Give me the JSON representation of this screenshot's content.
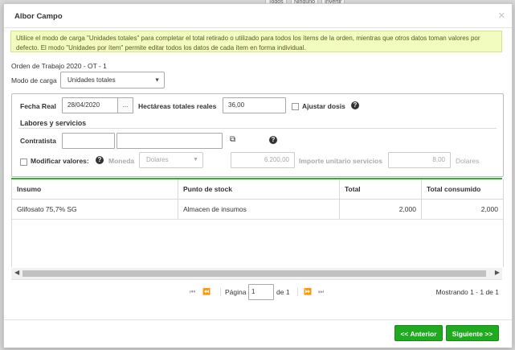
{
  "background": {
    "tabs": [
      "Todos",
      "Ninguno",
      "Invertir"
    ]
  },
  "dialog": {
    "title": "Albor Campo",
    "close_icon": "close-icon",
    "info": "Utilice el modo de carga \"Unidades totales\" para completar el total retirado o utilizado para todos los ítems de la orden, mientras que otros datos toman valores por defecto. El modo \"Unidades por ítem\" permite editar todos los datos de cada ítem en forma individual.",
    "order_label": "Orden de Trabajo 2020 - OT - 1",
    "mode_label": "Modo de carga",
    "mode_value": "Unidades totales",
    "form": {
      "fecha_label": "Fecha Real",
      "fecha_value": "28/04/2020",
      "fecha_btn": "...",
      "hectareas_label": "Hectáreas totales reales",
      "hectareas_value": "36,00",
      "ajustar_label": "Ajustar dosis",
      "section_title": "Labores y servicios",
      "contratista_label": "Contratista",
      "contratista_code": "",
      "contratista_name": "",
      "modificar_label": "Modificar valores:",
      "moneda_label": "Moneda",
      "moneda_value": "Dolares",
      "monto_value": "6.200,00",
      "importe_label": "Importe unitario servicios",
      "importe_value": "8,00",
      "importe_currency": "Dolares"
    },
    "grid": {
      "columns": [
        "Insumo",
        "Punto de stock",
        "Total",
        "Total consumido"
      ],
      "rows": [
        {
          "insumo": "Glifosato 75,7%  SG",
          "punto": "Almacen de insumos",
          "total": "2,000",
          "consumido": "2,000"
        }
      ]
    },
    "pager": {
      "page_label": "Página",
      "page_value": "1",
      "of_label": "de 1",
      "summary": "Mostrando 1 - 1 de 1"
    },
    "buttons": {
      "back": "<< Anterior",
      "next": "Siguiente >>"
    },
    "colors": {
      "accent_green": "#1faa1f",
      "info_bg": "#f2fcbf"
    }
  }
}
